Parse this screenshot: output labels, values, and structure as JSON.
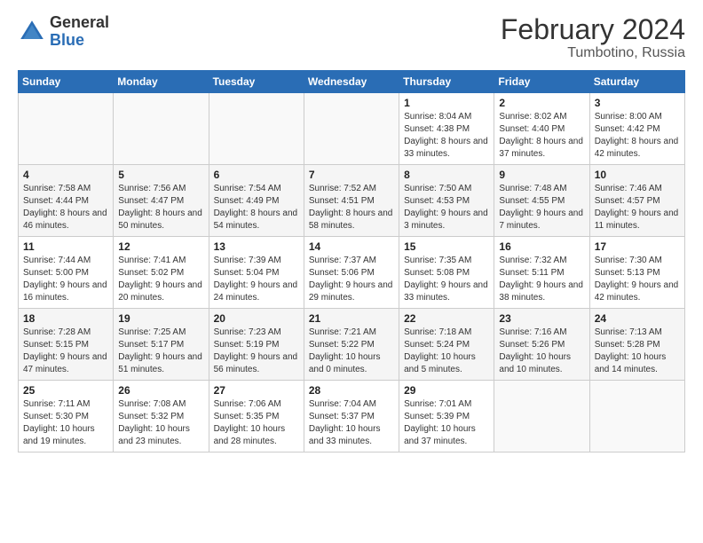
{
  "logo": {
    "general": "General",
    "blue": "Blue"
  },
  "title": "February 2024",
  "subtitle": "Tumbotino, Russia",
  "weekdays": [
    "Sunday",
    "Monday",
    "Tuesday",
    "Wednesday",
    "Thursday",
    "Friday",
    "Saturday"
  ],
  "weeks": [
    [
      {
        "day": "",
        "sunrise": "",
        "sunset": "",
        "daylight": ""
      },
      {
        "day": "",
        "sunrise": "",
        "sunset": "",
        "daylight": ""
      },
      {
        "day": "",
        "sunrise": "",
        "sunset": "",
        "daylight": ""
      },
      {
        "day": "",
        "sunrise": "",
        "sunset": "",
        "daylight": ""
      },
      {
        "day": "1",
        "sunrise": "Sunrise: 8:04 AM",
        "sunset": "Sunset: 4:38 PM",
        "daylight": "Daylight: 8 hours and 33 minutes."
      },
      {
        "day": "2",
        "sunrise": "Sunrise: 8:02 AM",
        "sunset": "Sunset: 4:40 PM",
        "daylight": "Daylight: 8 hours and 37 minutes."
      },
      {
        "day": "3",
        "sunrise": "Sunrise: 8:00 AM",
        "sunset": "Sunset: 4:42 PM",
        "daylight": "Daylight: 8 hours and 42 minutes."
      }
    ],
    [
      {
        "day": "4",
        "sunrise": "Sunrise: 7:58 AM",
        "sunset": "Sunset: 4:44 PM",
        "daylight": "Daylight: 8 hours and 46 minutes."
      },
      {
        "day": "5",
        "sunrise": "Sunrise: 7:56 AM",
        "sunset": "Sunset: 4:47 PM",
        "daylight": "Daylight: 8 hours and 50 minutes."
      },
      {
        "day": "6",
        "sunrise": "Sunrise: 7:54 AM",
        "sunset": "Sunset: 4:49 PM",
        "daylight": "Daylight: 8 hours and 54 minutes."
      },
      {
        "day": "7",
        "sunrise": "Sunrise: 7:52 AM",
        "sunset": "Sunset: 4:51 PM",
        "daylight": "Daylight: 8 hours and 58 minutes."
      },
      {
        "day": "8",
        "sunrise": "Sunrise: 7:50 AM",
        "sunset": "Sunset: 4:53 PM",
        "daylight": "Daylight: 9 hours and 3 minutes."
      },
      {
        "day": "9",
        "sunrise": "Sunrise: 7:48 AM",
        "sunset": "Sunset: 4:55 PM",
        "daylight": "Daylight: 9 hours and 7 minutes."
      },
      {
        "day": "10",
        "sunrise": "Sunrise: 7:46 AM",
        "sunset": "Sunset: 4:57 PM",
        "daylight": "Daylight: 9 hours and 11 minutes."
      }
    ],
    [
      {
        "day": "11",
        "sunrise": "Sunrise: 7:44 AM",
        "sunset": "Sunset: 5:00 PM",
        "daylight": "Daylight: 9 hours and 16 minutes."
      },
      {
        "day": "12",
        "sunrise": "Sunrise: 7:41 AM",
        "sunset": "Sunset: 5:02 PM",
        "daylight": "Daylight: 9 hours and 20 minutes."
      },
      {
        "day": "13",
        "sunrise": "Sunrise: 7:39 AM",
        "sunset": "Sunset: 5:04 PM",
        "daylight": "Daylight: 9 hours and 24 minutes."
      },
      {
        "day": "14",
        "sunrise": "Sunrise: 7:37 AM",
        "sunset": "Sunset: 5:06 PM",
        "daylight": "Daylight: 9 hours and 29 minutes."
      },
      {
        "day": "15",
        "sunrise": "Sunrise: 7:35 AM",
        "sunset": "Sunset: 5:08 PM",
        "daylight": "Daylight: 9 hours and 33 minutes."
      },
      {
        "day": "16",
        "sunrise": "Sunrise: 7:32 AM",
        "sunset": "Sunset: 5:11 PM",
        "daylight": "Daylight: 9 hours and 38 minutes."
      },
      {
        "day": "17",
        "sunrise": "Sunrise: 7:30 AM",
        "sunset": "Sunset: 5:13 PM",
        "daylight": "Daylight: 9 hours and 42 minutes."
      }
    ],
    [
      {
        "day": "18",
        "sunrise": "Sunrise: 7:28 AM",
        "sunset": "Sunset: 5:15 PM",
        "daylight": "Daylight: 9 hours and 47 minutes."
      },
      {
        "day": "19",
        "sunrise": "Sunrise: 7:25 AM",
        "sunset": "Sunset: 5:17 PM",
        "daylight": "Daylight: 9 hours and 51 minutes."
      },
      {
        "day": "20",
        "sunrise": "Sunrise: 7:23 AM",
        "sunset": "Sunset: 5:19 PM",
        "daylight": "Daylight: 9 hours and 56 minutes."
      },
      {
        "day": "21",
        "sunrise": "Sunrise: 7:21 AM",
        "sunset": "Sunset: 5:22 PM",
        "daylight": "Daylight: 10 hours and 0 minutes."
      },
      {
        "day": "22",
        "sunrise": "Sunrise: 7:18 AM",
        "sunset": "Sunset: 5:24 PM",
        "daylight": "Daylight: 10 hours and 5 minutes."
      },
      {
        "day": "23",
        "sunrise": "Sunrise: 7:16 AM",
        "sunset": "Sunset: 5:26 PM",
        "daylight": "Daylight: 10 hours and 10 minutes."
      },
      {
        "day": "24",
        "sunrise": "Sunrise: 7:13 AM",
        "sunset": "Sunset: 5:28 PM",
        "daylight": "Daylight: 10 hours and 14 minutes."
      }
    ],
    [
      {
        "day": "25",
        "sunrise": "Sunrise: 7:11 AM",
        "sunset": "Sunset: 5:30 PM",
        "daylight": "Daylight: 10 hours and 19 minutes."
      },
      {
        "day": "26",
        "sunrise": "Sunrise: 7:08 AM",
        "sunset": "Sunset: 5:32 PM",
        "daylight": "Daylight: 10 hours and 23 minutes."
      },
      {
        "day": "27",
        "sunrise": "Sunrise: 7:06 AM",
        "sunset": "Sunset: 5:35 PM",
        "daylight": "Daylight: 10 hours and 28 minutes."
      },
      {
        "day": "28",
        "sunrise": "Sunrise: 7:04 AM",
        "sunset": "Sunset: 5:37 PM",
        "daylight": "Daylight: 10 hours and 33 minutes."
      },
      {
        "day": "29",
        "sunrise": "Sunrise: 7:01 AM",
        "sunset": "Sunset: 5:39 PM",
        "daylight": "Daylight: 10 hours and 37 minutes."
      },
      {
        "day": "",
        "sunrise": "",
        "sunset": "",
        "daylight": ""
      },
      {
        "day": "",
        "sunrise": "",
        "sunset": "",
        "daylight": ""
      }
    ]
  ]
}
